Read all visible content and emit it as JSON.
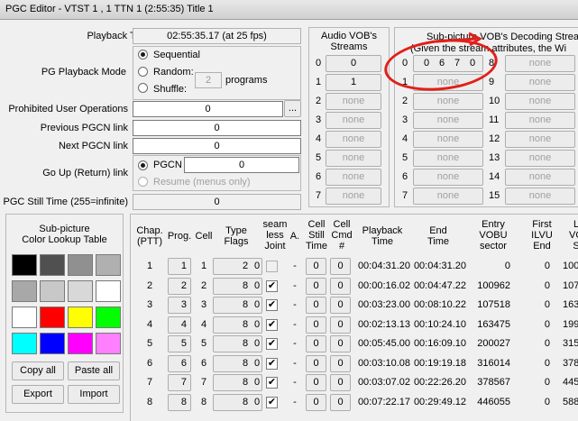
{
  "window": {
    "title": "PGC Editor - VTST 1 , 1   TTN 1 (2:55:35) Title 1"
  },
  "playback_time": {
    "label": "Playback Time",
    "value": "02:55:35.17 (at 25 fps)"
  },
  "pg_mode": {
    "label": "PG Playback Mode",
    "sequential": "Sequential",
    "random": "Random:",
    "shuffle": "Shuffle:",
    "programs_value": "2",
    "programs_label": "programs"
  },
  "prohibited": {
    "label": "Prohibited User Operations",
    "value": "0",
    "button": "..."
  },
  "prev_pgcn": {
    "label": "Previous PGCN link",
    "value": "0"
  },
  "next_pgcn": {
    "label": "Next PGCN link",
    "value": "0"
  },
  "goup": {
    "label": "Go Up (Return) link",
    "pgcn_label": "PGCN",
    "value": "0",
    "resume": "Resume (menus only)"
  },
  "still": {
    "label": "PGC Still Time (255=infinite)",
    "value": "0"
  },
  "audio": {
    "title_line1": "Audio VOB's",
    "title_line2": "Streams",
    "rows": [
      {
        "idx": "0",
        "val": "0"
      },
      {
        "idx": "1",
        "val": "1"
      },
      {
        "idx": "2",
        "val": "none"
      },
      {
        "idx": "3",
        "val": "none"
      },
      {
        "idx": "4",
        "val": "none"
      },
      {
        "idx": "5",
        "val": "none"
      },
      {
        "idx": "6",
        "val": "none"
      },
      {
        "idx": "7",
        "val": "none"
      }
    ]
  },
  "subpic": {
    "title_line1": "Sub-picture VOB's Decoding Stream",
    "title_line2": "(Given the stream attributes, the Wi",
    "left_rows": [
      {
        "idx": "0",
        "vals": [
          "0",
          "6",
          "7",
          "0"
        ]
      },
      {
        "idx": "1",
        "val": "none"
      },
      {
        "idx": "2",
        "val": "none"
      },
      {
        "idx": "3",
        "val": "none"
      },
      {
        "idx": "4",
        "val": "none"
      },
      {
        "idx": "5",
        "val": "none"
      },
      {
        "idx": "6",
        "val": "none"
      },
      {
        "idx": "7",
        "val": "none"
      }
    ],
    "right_rows": [
      {
        "idx": "8",
        "val": "none"
      },
      {
        "idx": "9",
        "val": "none"
      },
      {
        "idx": "10",
        "val": "none"
      },
      {
        "idx": "11",
        "val": "none"
      },
      {
        "idx": "12",
        "val": "none"
      },
      {
        "idx": "13",
        "val": "none"
      },
      {
        "idx": "14",
        "val": "none"
      },
      {
        "idx": "15",
        "val": "none"
      }
    ]
  },
  "clut": {
    "title_line1": "Sub-picture",
    "title_line2": "Color Lookup Table",
    "colors": [
      "#000000",
      "#505050",
      "#909090",
      "#b0b0b0",
      "#a8a8a8",
      "#c8c8c8",
      "#d8d8d8",
      "#ffffff",
      "#ffffff",
      "#ff0000",
      "#ffff00",
      "#00ff00",
      "#00ffff",
      "#0000ff",
      "#ff00ff",
      "#ff80ff"
    ],
    "copy_all": "Copy all",
    "paste_all": "Paste all",
    "export": "Export",
    "import": "Import"
  },
  "table": {
    "headers": {
      "chap": [
        "Chap.",
        "(PTT)"
      ],
      "prog": [
        "Prog."
      ],
      "cell": [
        "Cell"
      ],
      "type": [
        "Type",
        "Flags"
      ],
      "seam": [
        "seam",
        "less",
        "Joint"
      ],
      "a": [
        "A."
      ],
      "still": [
        "Cell",
        "Still",
        "Time"
      ],
      "cmd": [
        "Cell",
        "Cmd",
        "#"
      ],
      "playback": [
        "Playback",
        "Time"
      ],
      "end": [
        "End",
        "Time"
      ],
      "entry": [
        "Entry",
        "VOBU",
        "sector"
      ],
      "first": [
        "First",
        "ILVU",
        "End"
      ],
      "last": [
        "L",
        "VO",
        "S"
      ]
    },
    "rows": [
      {
        "chap": "1",
        "prog": "1",
        "cell": "1",
        "type": "2",
        "flags": "0",
        "seam": false,
        "a": "-",
        "still": "0",
        "cmd": "0",
        "playback": "00:04:31.20",
        "end": "00:04:31.20",
        "entry": "0",
        "first": "0",
        "last": "100"
      },
      {
        "chap": "2",
        "prog": "2",
        "cell": "2",
        "type": "8",
        "flags": "0",
        "seam": true,
        "a": "-",
        "still": "0",
        "cmd": "0",
        "playback": "00:00:16.02",
        "end": "00:04:47.22",
        "entry": "100962",
        "first": "0",
        "last": "107"
      },
      {
        "chap": "3",
        "prog": "3",
        "cell": "3",
        "type": "8",
        "flags": "0",
        "seam": true,
        "a": "-",
        "still": "0",
        "cmd": "0",
        "playback": "00:03:23.00",
        "end": "00:08:10.22",
        "entry": "107518",
        "first": "0",
        "last": "163"
      },
      {
        "chap": "4",
        "prog": "4",
        "cell": "4",
        "type": "8",
        "flags": "0",
        "seam": true,
        "a": "-",
        "still": "0",
        "cmd": "0",
        "playback": "00:02:13.13",
        "end": "00:10:24.10",
        "entry": "163475",
        "first": "0",
        "last": "199"
      },
      {
        "chap": "5",
        "prog": "5",
        "cell": "5",
        "type": "8",
        "flags": "0",
        "seam": true,
        "a": "-",
        "still": "0",
        "cmd": "0",
        "playback": "00:05:45.00",
        "end": "00:16:09.10",
        "entry": "200027",
        "first": "0",
        "last": "315"
      },
      {
        "chap": "6",
        "prog": "6",
        "cell": "6",
        "type": "8",
        "flags": "0",
        "seam": true,
        "a": "-",
        "still": "0",
        "cmd": "0",
        "playback": "00:03:10.08",
        "end": "00:19:19.18",
        "entry": "316014",
        "first": "0",
        "last": "378"
      },
      {
        "chap": "7",
        "prog": "7",
        "cell": "7",
        "type": "8",
        "flags": "0",
        "seam": true,
        "a": "-",
        "still": "0",
        "cmd": "0",
        "playback": "00:03:07.02",
        "end": "00:22:26.20",
        "entry": "378567",
        "first": "0",
        "last": "445"
      },
      {
        "chap": "8",
        "prog": "8",
        "cell": "8",
        "type": "8",
        "flags": "0",
        "seam": true,
        "a": "-",
        "still": "0",
        "cmd": "0",
        "playback": "00:07:22.17",
        "end": "00:29:49.12",
        "entry": "446055",
        "first": "0",
        "last": "588"
      }
    ]
  }
}
